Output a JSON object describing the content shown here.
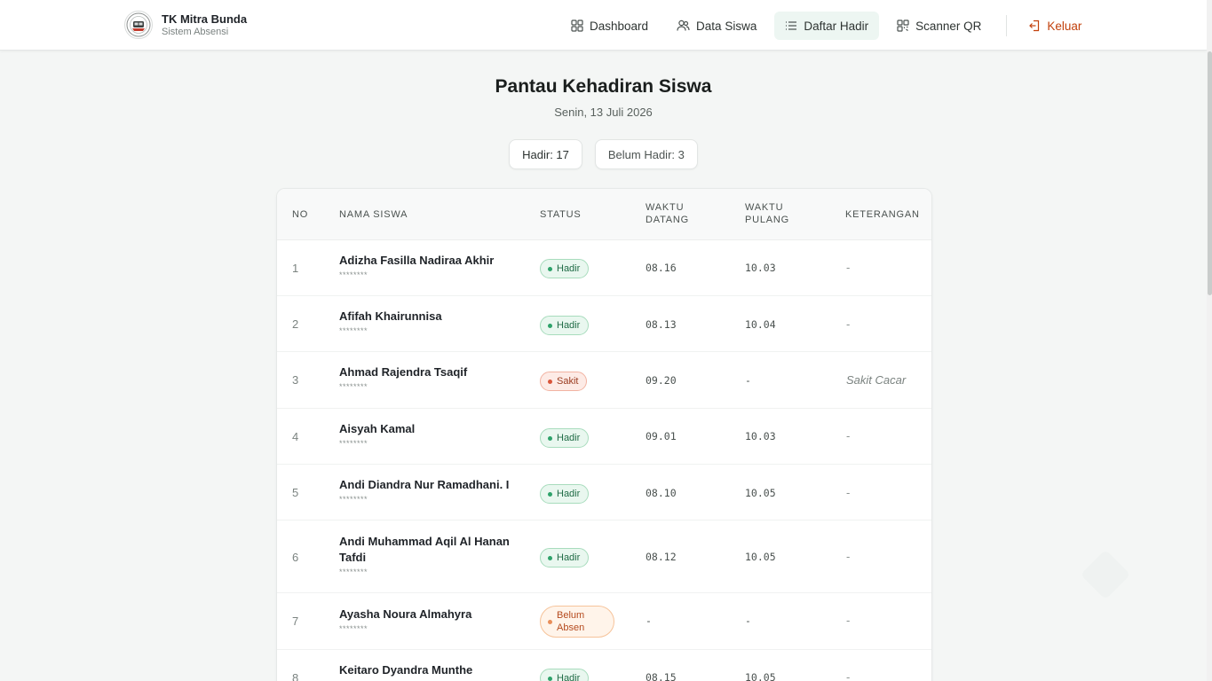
{
  "brand": {
    "title": "TK Mitra Bunda",
    "subtitle": "Sistem Absensi"
  },
  "nav": {
    "dashboard": "Dashboard",
    "data_siswa": "Data Siswa",
    "daftar_hadir": "Daftar Hadir",
    "scanner_qr": "Scanner QR",
    "keluar": "Keluar",
    "active": "Daftar Hadir",
    "logout_color": "#c2410c"
  },
  "page": {
    "title": "Pantau Kehadiran Siswa",
    "date": "Senin, 13 Juli 2026"
  },
  "stats": {
    "hadir": "Hadir: 17",
    "belum_hadir": "Belum Hadir: 3"
  },
  "table": {
    "headers": {
      "no": "NO",
      "nama": "NAMA SISWA",
      "status": "STATUS",
      "datang_1": "WAKTU",
      "datang_2": "DATANG",
      "pulang_1": "WAKTU",
      "pulang_2": "PULANG",
      "keterangan": "KETERANGAN"
    },
    "rows": [
      {
        "no": "1",
        "name": "Adizha Fasilla Nadiraa Akhir",
        "masked": "********",
        "status": "Hadir",
        "datang": "08.16",
        "pulang": "10.03",
        "ket": "-"
      },
      {
        "no": "2",
        "name": "Afifah Khairunnisa",
        "masked": "********",
        "status": "Hadir",
        "datang": "08.13",
        "pulang": "10.04",
        "ket": "-"
      },
      {
        "no": "3",
        "name": "Ahmad Rajendra Tsaqif",
        "masked": "********",
        "status": "Sakit",
        "datang": "09.20",
        "pulang": "-",
        "ket": "Sakit Cacar"
      },
      {
        "no": "4",
        "name": "Aisyah Kamal",
        "masked": "********",
        "status": "Hadir",
        "datang": "09.01",
        "pulang": "10.03",
        "ket": "-"
      },
      {
        "no": "5",
        "name": "Andi Diandra Nur Ramadhani. I",
        "masked": "********",
        "status": "Hadir",
        "datang": "08.10",
        "pulang": "10.05",
        "ket": "-"
      },
      {
        "no": "6",
        "name_line1": "Andi Muhammad Aqil Al Hanan",
        "name_line2": "Tafdi",
        "masked": "********",
        "status": "Hadir",
        "datang": "08.12",
        "pulang": "10.05",
        "ket": "-"
      },
      {
        "no": "7",
        "name": "Ayasha Noura Almahyra",
        "masked": "********",
        "status_line1": "Belum",
        "status_line2": "Absen",
        "datang": "-",
        "pulang": "-",
        "ket": "-"
      },
      {
        "no": "8",
        "name": "Keitaro Dyandra Munthe",
        "masked": "********",
        "status": "Hadir",
        "datang": "08.15",
        "pulang": "10.05",
        "ket": "-"
      }
    ]
  },
  "colors": {
    "hadir": "#2ea26a",
    "sakit": "#d9553a",
    "belum_absen": "#e88e5a",
    "active_nav_bg": "#edf6f2"
  }
}
